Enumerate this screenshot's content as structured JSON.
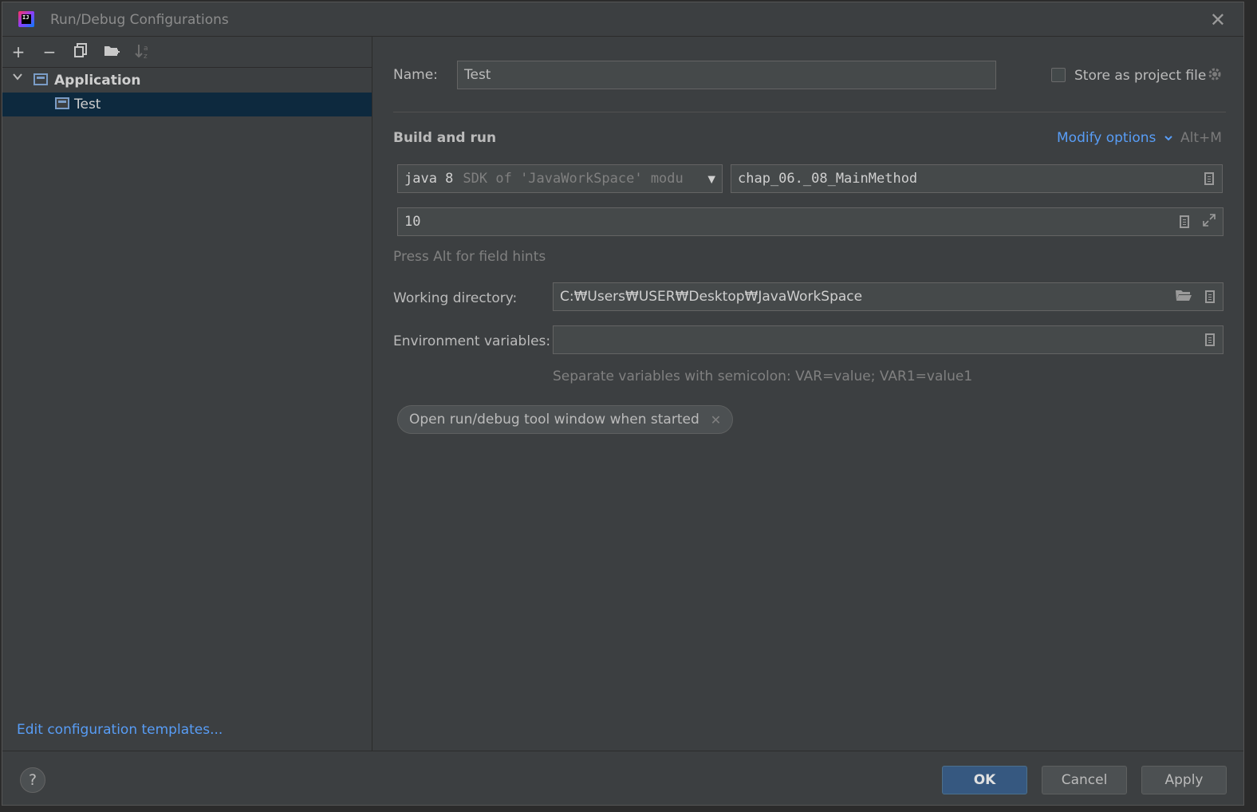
{
  "window": {
    "title": "Run/Debug Configurations",
    "close_icon": "close-icon"
  },
  "toolbar": {
    "add": "+",
    "remove": "−",
    "copy_icon": "copy-icon",
    "folder_icon": "new-folder-icon",
    "sort_icon": "sort-alpha-icon"
  },
  "tree": {
    "group_label": "Application",
    "item_label": "Test"
  },
  "left_footer": {
    "edit_templates": "Edit configuration templates..."
  },
  "form": {
    "name_label": "Name:",
    "name_value": "Test",
    "store_as_project_file": "Store as project file",
    "section_title": "Build and run",
    "modify_options": "Modify options",
    "modify_shortcut": "Alt+M",
    "jre_primary": "java 8",
    "jre_secondary": "SDK of 'JavaWorkSpace' modu",
    "main_class": "chap_06._08_MainMethod",
    "program_args": "10",
    "field_hints": "Press Alt for field hints",
    "working_dir_label": "Working directory:",
    "working_dir_value": "C:₩Users₩USER₩Desktop₩JavaWorkSpace",
    "env_label": "Environment variables:",
    "env_value": "",
    "env_hint": "Separate variables with semicolon: VAR=value; VAR1=value1",
    "chip_label": "Open run/debug tool window when started"
  },
  "buttons": {
    "help": "?",
    "ok": "OK",
    "cancel": "Cancel",
    "apply": "Apply"
  },
  "colors": {
    "accent_link": "#589df6",
    "selection": "#0d293e",
    "primary_button": "#365880"
  }
}
